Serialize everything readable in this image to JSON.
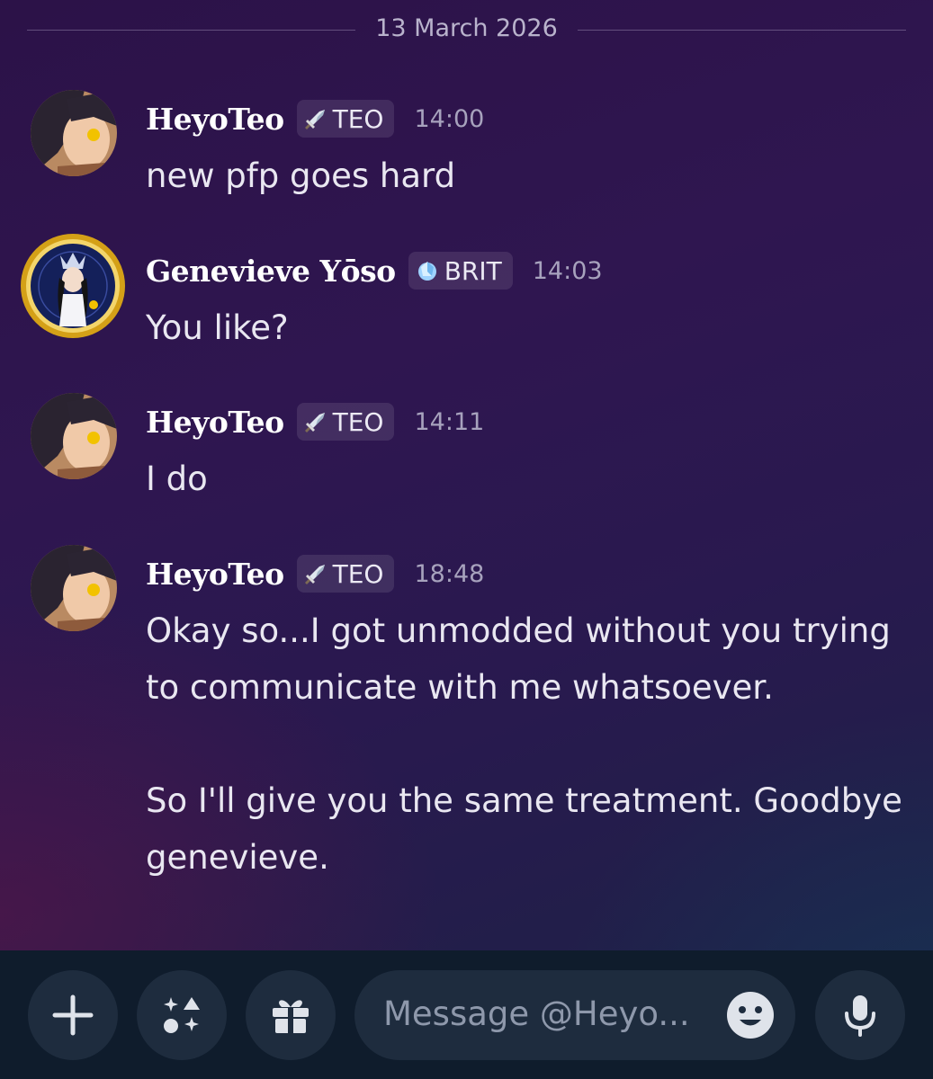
{
  "date_divider": "13 March 2026",
  "messages": [
    {
      "author": "HeyoTeo",
      "tag": "TEO",
      "tag_icon": "sword-icon",
      "time": "14:00",
      "lines": [
        "new pfp goes hard"
      ]
    },
    {
      "author": "Genevieve Yōso",
      "tag": "BRIT",
      "tag_icon": "crystal-icon",
      "time": "14:03",
      "lines": [
        "You like?"
      ]
    },
    {
      "author": "HeyoTeo",
      "tag": "TEO",
      "tag_icon": "sword-icon",
      "time": "14:11",
      "lines": [
        "I do"
      ]
    },
    {
      "author": "HeyoTeo",
      "tag": "TEO",
      "tag_icon": "sword-icon",
      "time": "18:48",
      "lines": [
        "Okay so...I got unmodded without you trying",
        "to communicate with me whatsoever.",
        "",
        "So I'll give you the same treatment. Goodbye",
        "genevieve."
      ]
    }
  ],
  "composer": {
    "placeholder": "Message @Heyo...",
    "buttons": [
      "plus-icon",
      "apps-icon",
      "gift-icon",
      "emoji-icon",
      "microphone-icon"
    ]
  },
  "colors": {
    "background": "#2c1248",
    "composer_bar": "#0f1c2c",
    "composer_button": "#1e2c3e",
    "avatar_ring": "#d4a017"
  }
}
